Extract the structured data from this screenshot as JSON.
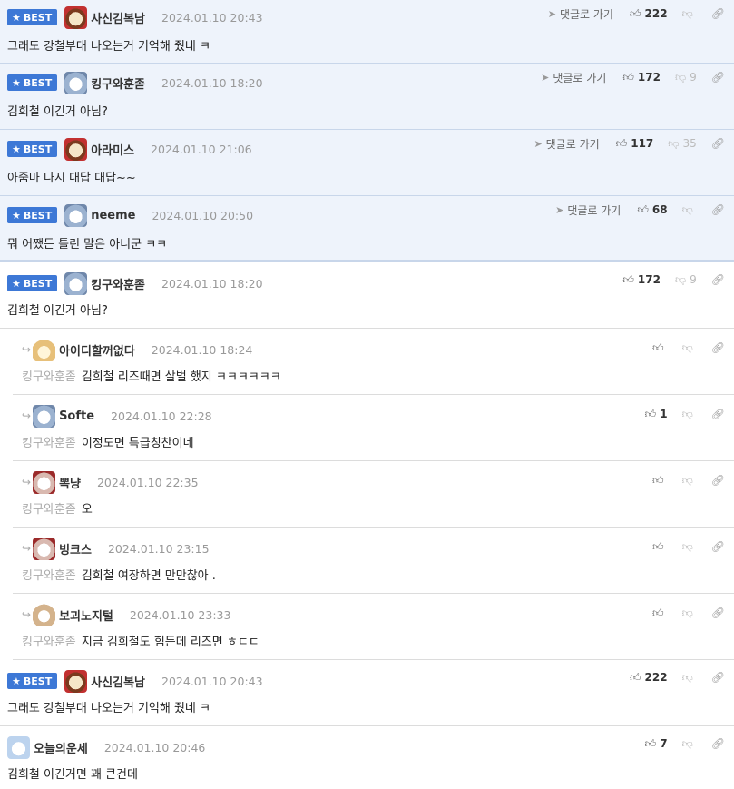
{
  "labels": {
    "best": "BEST",
    "goto_comment": "댓글로 가기"
  },
  "best_top": [
    {
      "nick": "사신김복남",
      "date": "2024.01.10 20:43",
      "text": "그래도 강철부대 나오는거 기억해 줬네 ㅋ",
      "up": "222",
      "down": ""
    },
    {
      "nick": "킹구와훈졷",
      "date": "2024.01.10 18:20",
      "text": "김희철 이긴거 아님?",
      "up": "172",
      "down": "9"
    },
    {
      "nick": "아라미스",
      "date": "2024.01.10 21:06",
      "text": "아줌마 다시 대답 대답~~",
      "up": "117",
      "down": "35"
    },
    {
      "nick": "neeme",
      "date": "2024.01.10 20:50",
      "text": "뭐 어쨌든 틀린 말은 아니군 ㅋㅋ",
      "up": "68",
      "down": ""
    }
  ],
  "thread": {
    "main": {
      "nick": "킹구와훈졷",
      "date": "2024.01.10 18:20",
      "text": "김희철 이긴거 아님?",
      "up": "172",
      "down": "9"
    },
    "replies": [
      {
        "nick": "아이디할꺼없다",
        "date": "2024.01.10 18:24",
        "target": "킹구와훈졷",
        "text": "김희철 리즈때면 살벌 했지 ㅋㅋㅋㅋㅋㅋ",
        "up": "",
        "down": ""
      },
      {
        "nick": "Softe",
        "date": "2024.01.10 22:28",
        "target": "킹구와훈졷",
        "text": "이정도면 특급칭찬이네",
        "up": "1",
        "down": ""
      },
      {
        "nick": "뽁냥",
        "date": "2024.01.10 22:35",
        "target": "킹구와훈졷",
        "text": "오",
        "up": "",
        "down": ""
      },
      {
        "nick": "빙크스",
        "date": "2024.01.10 23:15",
        "target": "킹구와훈졷",
        "text": "김희철 여장하면 만만찮아 .",
        "up": "",
        "down": ""
      },
      {
        "nick": "보괴노지털",
        "date": "2024.01.10 23:33",
        "target": "킹구와훈졷",
        "text": "지금 김희철도 힘든데 리즈면 ㅎㄷㄷ",
        "up": "",
        "down": ""
      }
    ]
  },
  "after": [
    {
      "nick": "사신김복남",
      "date": "2024.01.10 20:43",
      "text": "그래도 강철부대 나오는거 기억해 줬네 ㅋ",
      "up": "222",
      "down": ""
    },
    {
      "nick": "오늘의운세",
      "date": "2024.01.10 20:46",
      "text": "김희철 이긴거면 꽤 큰건데",
      "up": "7",
      "down": ""
    }
  ]
}
